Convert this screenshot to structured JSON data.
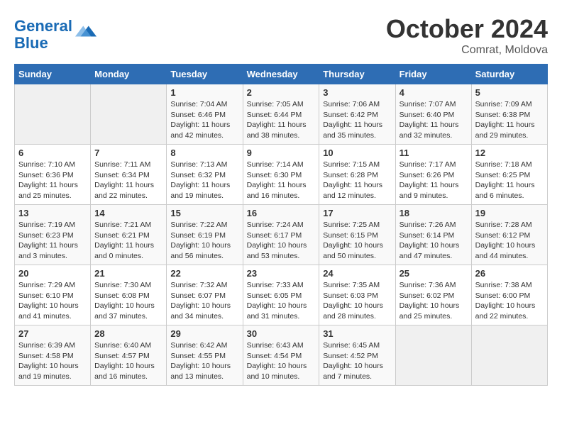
{
  "header": {
    "logo_line1": "General",
    "logo_line2": "Blue",
    "month": "October 2024",
    "location": "Comrat, Moldova"
  },
  "weekdays": [
    "Sunday",
    "Monday",
    "Tuesday",
    "Wednesday",
    "Thursday",
    "Friday",
    "Saturday"
  ],
  "weeks": [
    [
      {
        "day": "",
        "info": ""
      },
      {
        "day": "",
        "info": ""
      },
      {
        "day": "1",
        "info": "Sunrise: 7:04 AM\nSunset: 6:46 PM\nDaylight: 11 hours and 42 minutes."
      },
      {
        "day": "2",
        "info": "Sunrise: 7:05 AM\nSunset: 6:44 PM\nDaylight: 11 hours and 38 minutes."
      },
      {
        "day": "3",
        "info": "Sunrise: 7:06 AM\nSunset: 6:42 PM\nDaylight: 11 hours and 35 minutes."
      },
      {
        "day": "4",
        "info": "Sunrise: 7:07 AM\nSunset: 6:40 PM\nDaylight: 11 hours and 32 minutes."
      },
      {
        "day": "5",
        "info": "Sunrise: 7:09 AM\nSunset: 6:38 PM\nDaylight: 11 hours and 29 minutes."
      }
    ],
    [
      {
        "day": "6",
        "info": "Sunrise: 7:10 AM\nSunset: 6:36 PM\nDaylight: 11 hours and 25 minutes."
      },
      {
        "day": "7",
        "info": "Sunrise: 7:11 AM\nSunset: 6:34 PM\nDaylight: 11 hours and 22 minutes."
      },
      {
        "day": "8",
        "info": "Sunrise: 7:13 AM\nSunset: 6:32 PM\nDaylight: 11 hours and 19 minutes."
      },
      {
        "day": "9",
        "info": "Sunrise: 7:14 AM\nSunset: 6:30 PM\nDaylight: 11 hours and 16 minutes."
      },
      {
        "day": "10",
        "info": "Sunrise: 7:15 AM\nSunset: 6:28 PM\nDaylight: 11 hours and 12 minutes."
      },
      {
        "day": "11",
        "info": "Sunrise: 7:17 AM\nSunset: 6:26 PM\nDaylight: 11 hours and 9 minutes."
      },
      {
        "day": "12",
        "info": "Sunrise: 7:18 AM\nSunset: 6:25 PM\nDaylight: 11 hours and 6 minutes."
      }
    ],
    [
      {
        "day": "13",
        "info": "Sunrise: 7:19 AM\nSunset: 6:23 PM\nDaylight: 11 hours and 3 minutes."
      },
      {
        "day": "14",
        "info": "Sunrise: 7:21 AM\nSunset: 6:21 PM\nDaylight: 11 hours and 0 minutes."
      },
      {
        "day": "15",
        "info": "Sunrise: 7:22 AM\nSunset: 6:19 PM\nDaylight: 10 hours and 56 minutes."
      },
      {
        "day": "16",
        "info": "Sunrise: 7:24 AM\nSunset: 6:17 PM\nDaylight: 10 hours and 53 minutes."
      },
      {
        "day": "17",
        "info": "Sunrise: 7:25 AM\nSunset: 6:15 PM\nDaylight: 10 hours and 50 minutes."
      },
      {
        "day": "18",
        "info": "Sunrise: 7:26 AM\nSunset: 6:14 PM\nDaylight: 10 hours and 47 minutes."
      },
      {
        "day": "19",
        "info": "Sunrise: 7:28 AM\nSunset: 6:12 PM\nDaylight: 10 hours and 44 minutes."
      }
    ],
    [
      {
        "day": "20",
        "info": "Sunrise: 7:29 AM\nSunset: 6:10 PM\nDaylight: 10 hours and 41 minutes."
      },
      {
        "day": "21",
        "info": "Sunrise: 7:30 AM\nSunset: 6:08 PM\nDaylight: 10 hours and 37 minutes."
      },
      {
        "day": "22",
        "info": "Sunrise: 7:32 AM\nSunset: 6:07 PM\nDaylight: 10 hours and 34 minutes."
      },
      {
        "day": "23",
        "info": "Sunrise: 7:33 AM\nSunset: 6:05 PM\nDaylight: 10 hours and 31 minutes."
      },
      {
        "day": "24",
        "info": "Sunrise: 7:35 AM\nSunset: 6:03 PM\nDaylight: 10 hours and 28 minutes."
      },
      {
        "day": "25",
        "info": "Sunrise: 7:36 AM\nSunset: 6:02 PM\nDaylight: 10 hours and 25 minutes."
      },
      {
        "day": "26",
        "info": "Sunrise: 7:38 AM\nSunset: 6:00 PM\nDaylight: 10 hours and 22 minutes."
      }
    ],
    [
      {
        "day": "27",
        "info": "Sunrise: 6:39 AM\nSunset: 4:58 PM\nDaylight: 10 hours and 19 minutes."
      },
      {
        "day": "28",
        "info": "Sunrise: 6:40 AM\nSunset: 4:57 PM\nDaylight: 10 hours and 16 minutes."
      },
      {
        "day": "29",
        "info": "Sunrise: 6:42 AM\nSunset: 4:55 PM\nDaylight: 10 hours and 13 minutes."
      },
      {
        "day": "30",
        "info": "Sunrise: 6:43 AM\nSunset: 4:54 PM\nDaylight: 10 hours and 10 minutes."
      },
      {
        "day": "31",
        "info": "Sunrise: 6:45 AM\nSunset: 4:52 PM\nDaylight: 10 hours and 7 minutes."
      },
      {
        "day": "",
        "info": ""
      },
      {
        "day": "",
        "info": ""
      }
    ]
  ]
}
